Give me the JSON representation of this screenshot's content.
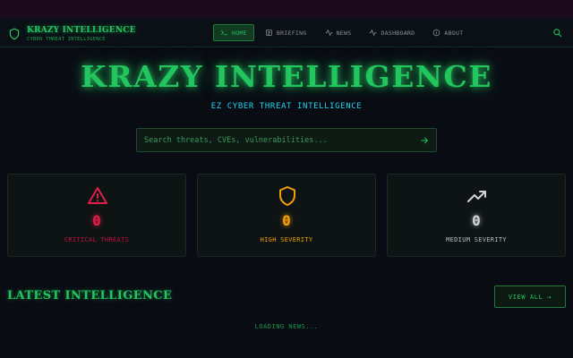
{
  "navbar": {
    "brand_title": "KRAZY INTELLIGENCE",
    "brand_subtitle": "CYBER THREAT INTELLIGENCE",
    "items": [
      {
        "label": "HOME",
        "icon": "terminal-icon",
        "active": true
      },
      {
        "label": "BRIEFING",
        "icon": "newspaper-icon",
        "active": false
      },
      {
        "label": "NEWS",
        "icon": "activity-icon",
        "active": false
      },
      {
        "label": "DASHBOARD",
        "icon": "activity-icon",
        "active": false
      },
      {
        "label": "ABOUT",
        "icon": "info-icon",
        "active": false
      }
    ]
  },
  "hero": {
    "title": "KRAZY INTELLIGENCE",
    "subtitle": "EZ CYBER THREAT INTELLIGENCE"
  },
  "search": {
    "placeholder": "Search threats, CVEs, vulnerabilities..."
  },
  "stats": [
    {
      "value": "0",
      "label": "CRITICAL THREATS",
      "icon": "alert-triangle-icon",
      "color": "#e11d48"
    },
    {
      "value": "0",
      "label": "HIGH SEVERITY",
      "icon": "shield-icon",
      "color": "#f59e0b"
    },
    {
      "value": "0",
      "label": "MEDIUM SEVERITY",
      "icon": "trending-up-icon",
      "color": "#d1d5db"
    }
  ],
  "latest": {
    "title": "LATEST INTELLIGENCE",
    "view_all": "VIEW ALL →",
    "loading": "LOADING NEWS..."
  },
  "colors": {
    "accent": "#22c55e",
    "cyan": "#22d3ee",
    "background": "#0a0c14"
  }
}
